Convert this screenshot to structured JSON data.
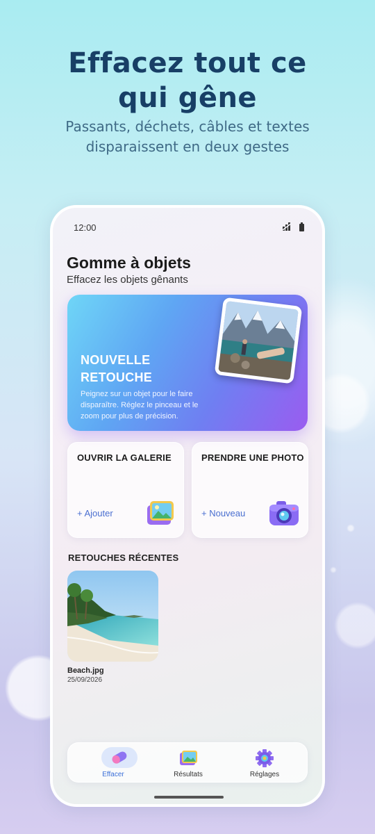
{
  "promo": {
    "headline": "Effacez tout ce qui gêne",
    "subline": "Passants, déchets, câbles et textes disparaissent en deux gestes"
  },
  "status": {
    "time": "12:00",
    "signal_icon": "signal-icon",
    "battery_icon": "battery-icon"
  },
  "app": {
    "title": "Gomme à objets",
    "subtitle": "Effacez les objets gênants"
  },
  "hero": {
    "title": "NOUVELLE RETOUCHE",
    "description": "Peignez sur un objet pour le faire disparaître. Réglez le pinceau et le zoom pour plus de précision.",
    "photo_icon": "lake-photo-icon"
  },
  "tiles": [
    {
      "title": "OUVRIR LA GALERIE",
      "action": "+ Ajouter",
      "icon": "gallery-icon"
    },
    {
      "title": "PRENDRE UNE PHOTO",
      "action": "+ Nouveau",
      "icon": "camera-icon"
    }
  ],
  "recent": {
    "section_title": "RETOUCHES RÉCENTES",
    "items": [
      {
        "name": "Beach.jpg",
        "date": "25/09/2026"
      }
    ]
  },
  "nav": {
    "items": [
      {
        "label": "Effacer",
        "icon": "eraser-icon",
        "active": true
      },
      {
        "label": "Résultats",
        "icon": "results-icon",
        "active": false
      },
      {
        "label": "Réglages",
        "icon": "gear-icon",
        "active": false
      }
    ]
  },
  "colors": {
    "accent": "#4a6fd0",
    "headline": "#183f66",
    "hero_start": "#6fd6f7",
    "hero_end": "#9a5cf0"
  }
}
